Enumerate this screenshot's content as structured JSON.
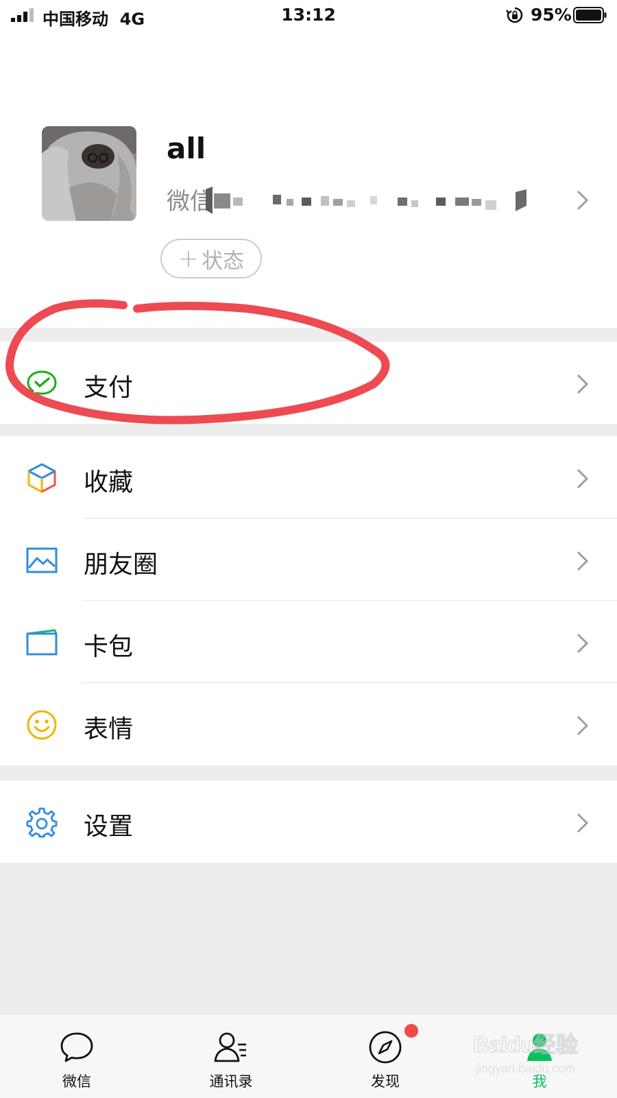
{
  "status_bar": {
    "carrier": "中国移动",
    "network": "4G",
    "time": "13:12",
    "battery": "95%"
  },
  "profile": {
    "nickname": "all",
    "wechat_id_label": "微信",
    "status_button": "状态"
  },
  "menu": {
    "pay": "支付",
    "favorites": "收藏",
    "moments": "朋友圈",
    "cards": "卡包",
    "stickers": "表情",
    "settings": "设置"
  },
  "tabbar": {
    "chats": "微信",
    "contacts": "通讯录",
    "discover": "发现",
    "me": "我"
  },
  "watermark": {
    "brand": "Baidu经验",
    "url": "jingyan.baidu.com"
  },
  "colors": {
    "accent": "#07c160",
    "annotation": "#ee4a52",
    "badge": "#f04a4a",
    "divider": "#e4e4e4"
  }
}
